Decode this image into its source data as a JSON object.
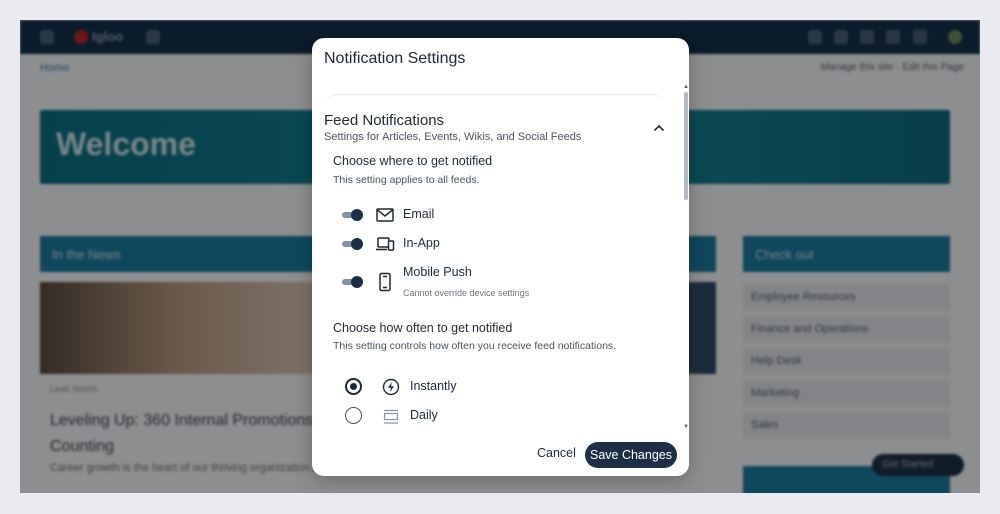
{
  "background": {
    "logo_text": "Igloo",
    "breadcrumb": "Home",
    "crumbs_right": "Manage this site · Edit this Page",
    "welcome": "Welcome",
    "news_header": "In the News",
    "news_meta": "Leah Welch",
    "news_title": "Leveling Up: 360 Internal Promotions Counting",
    "news_body": "Career growth is the heart of our thriving organization...",
    "check_header": "Check out",
    "check_items": [
      "Employee Resources",
      "Finance and Operations",
      "Help Desk",
      "Marketing",
      "Sales"
    ],
    "help_label": "Get Started"
  },
  "modal": {
    "title": "Notification Settings",
    "section": {
      "title": "Feed Notifications",
      "subtitle": "Settings for Articles, Events, Wikis, and Social Feeds"
    },
    "where": {
      "title": "Choose where to get notified",
      "subtitle": "This setting applies to all feeds.",
      "channels": [
        {
          "label": "Email",
          "icon": "mail-icon",
          "enabled": true
        },
        {
          "label": "In-App",
          "icon": "devices-icon",
          "enabled": true
        },
        {
          "label": "Mobile Push",
          "icon": "smartphone-icon",
          "enabled": true,
          "note": "Cannot override device settings"
        }
      ]
    },
    "frequency": {
      "title": "Choose how often to get notified",
      "subtitle": "This setting controls how often you receive feed notifications.",
      "options": [
        {
          "label": "Instantly",
          "icon": "lightning-icon",
          "selected": true
        },
        {
          "label": "Daily",
          "icon": "digest-icon",
          "selected": false
        }
      ]
    },
    "buttons": {
      "cancel": "Cancel",
      "save": "Save Changes"
    }
  },
  "colors": {
    "primary_dark": "#1c2f45",
    "overlay": "rgba(0,0,0,0.42)",
    "banner_teal": "#1b7ca0"
  }
}
